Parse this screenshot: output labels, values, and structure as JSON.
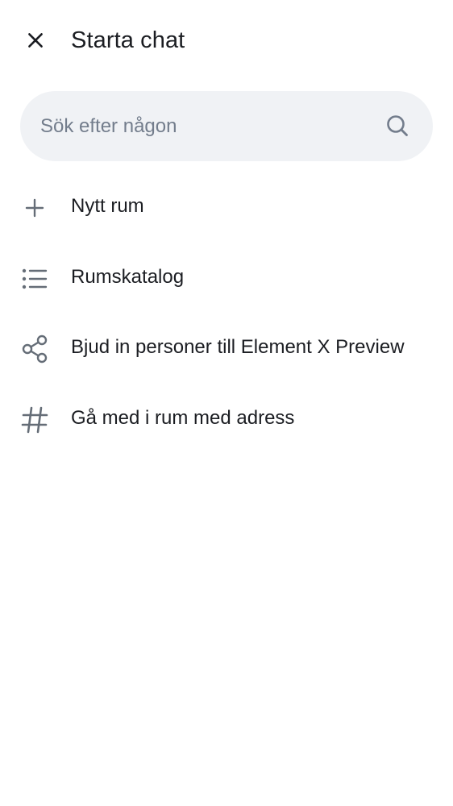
{
  "header": {
    "title": "Starta chat",
    "close_icon": "close-icon"
  },
  "search": {
    "placeholder": "Sök efter någon",
    "value": "",
    "icon": "search-icon"
  },
  "menu": {
    "items": [
      {
        "label": "Nytt rum",
        "icon": "plus-icon"
      },
      {
        "label": "Rumskatalog",
        "icon": "list-icon"
      },
      {
        "label": "Bjud in personer till Element X Preview",
        "icon": "share-icon"
      },
      {
        "label": "Gå med i rum med adress",
        "icon": "hash-icon"
      }
    ]
  },
  "colors": {
    "text_primary": "#1b1d22",
    "text_secondary": "#737d8c",
    "icon": "#656d77",
    "search_bg": "#f0f2f5",
    "background": "#ffffff"
  }
}
